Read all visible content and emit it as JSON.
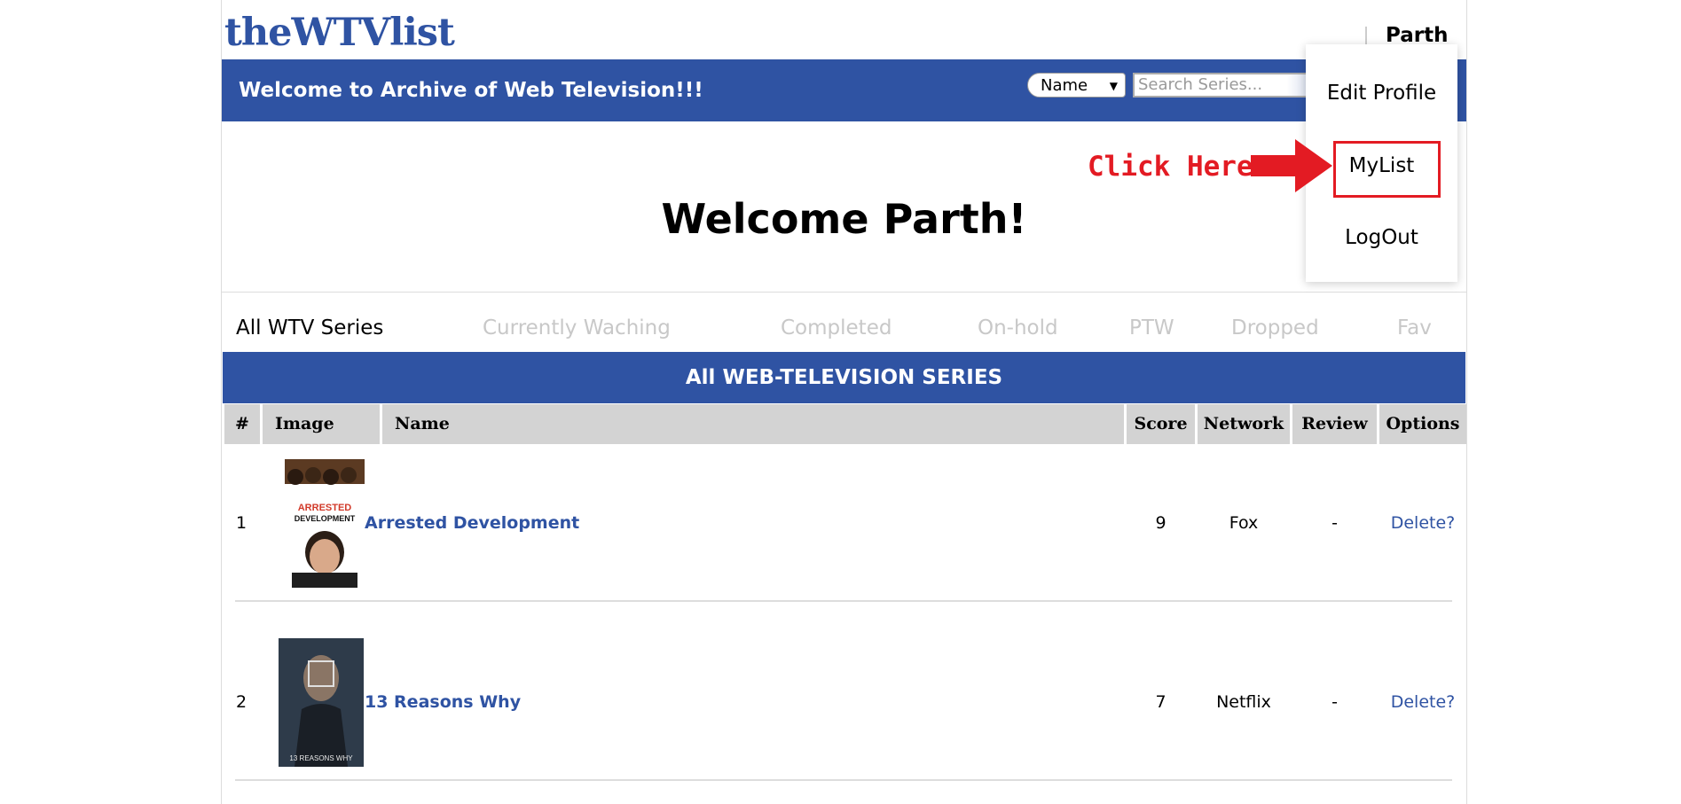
{
  "brand": {
    "logo_text": "theWTVlist"
  },
  "user": {
    "name": "Parth"
  },
  "navbar": {
    "banner": "Welcome to Archive of Web Television!!!",
    "search_select_value": "Name",
    "search_placeholder": "Search Series..."
  },
  "dropdown": {
    "items": [
      "Edit Profile",
      "MyList",
      "LogOut"
    ]
  },
  "annotation": {
    "text": "Click Here",
    "color": "#e31b23"
  },
  "welcome": {
    "title": "Welcome Parth!"
  },
  "tabs": [
    "All WTV Series",
    "Currently Waching",
    "Completed",
    "On-hold",
    "PTW",
    "Dropped",
    "Fav"
  ],
  "section": {
    "title": "All WEB-TELEVISION SERIES"
  },
  "table": {
    "headers": [
      "#",
      "Image",
      "Name",
      "Score",
      "Network",
      "Review",
      "Options"
    ],
    "rows": [
      {
        "num": "1",
        "name": "Arrested Development",
        "score": "9",
        "network": "Fox",
        "review": "-",
        "option": "Delete?",
        "poster_text": [
          "ARRESTED",
          "DEVELOPMENT"
        ]
      },
      {
        "num": "2",
        "name": "13 Reasons Why",
        "score": "7",
        "network": "Netflix",
        "review": "-",
        "option": "Delete?",
        "poster_text": [
          "13 REASONS WHY"
        ]
      }
    ]
  },
  "colors": {
    "brand_blue": "#2f53a3",
    "accent_red": "#e31b23",
    "header_gray": "#d3d3d3"
  }
}
